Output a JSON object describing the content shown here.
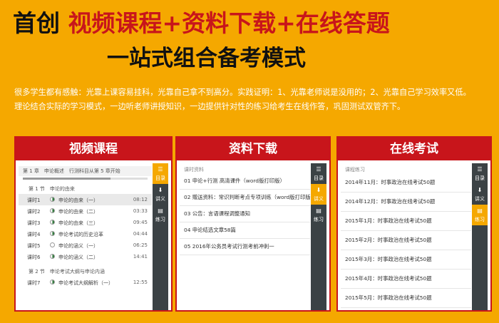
{
  "hero": {
    "part1": "首创 ",
    "part2": "视频课程+资料下载+在线答题",
    "line2": "一站式组合备考模式"
  },
  "intro": {
    "line1": "很多学生都有感触：光靠上课容易挂科，光靠自己拿不到高分。实践证明：1、光靠老师说是没用的；2、光靠自己学习效率又低。",
    "line2": "理论结合实际的学习模式，一边听老师讲授知识，一边提供针对性的练习给考生在线作答，巩固测试双管齐下。"
  },
  "sidebar": {
    "catalog": "目录",
    "handout": "讲义",
    "practice": "练习"
  },
  "video_card": {
    "title": "视频课程",
    "chapter": "第 1 章　申论概述　行测科目从第 5 章开始",
    "section1": "第 1 节　申论的由来",
    "lessons": [
      {
        "code": "课时1",
        "title": "申论的由来（一）",
        "time": "08:12",
        "active": true,
        "watched": true
      },
      {
        "code": "课时2",
        "title": "申论的由来（二）",
        "time": "03:33",
        "active": false,
        "watched": true
      },
      {
        "code": "课时3",
        "title": "申论的由来（三）",
        "time": "09:45",
        "active": false,
        "watched": true
      },
      {
        "code": "课时4",
        "title": "申论考试的历史沿革",
        "time": "04:44",
        "active": false,
        "watched": true
      },
      {
        "code": "课时5",
        "title": "申论的涵义（一）",
        "time": "06:25",
        "active": false,
        "watched": false
      },
      {
        "code": "课时6",
        "title": "申论的涵义（二）",
        "time": "14:41",
        "active": false,
        "watched": true
      }
    ],
    "section2": "第 2 节　申论考试大纲与申论内涵",
    "lesson7": {
      "code": "课时7",
      "title": "申论考试大纲解析（一）",
      "time": "12:55"
    }
  },
  "materials_card": {
    "title": "资料下载",
    "header": "课时资料",
    "items": [
      "01 申论+行测 高清课件（word版打印版）",
      "02 赠送资料：常识判断考点专项训练（word版打印版）",
      "03 公告：言语课程调整通知",
      "04 申论结选文章58篇",
      "05 2016年公务员考试行测考前冲刺一"
    ]
  },
  "exam_card": {
    "title": "在线考试",
    "header": "课程练习",
    "items": [
      "2014年11月：时事政治在线考试50题",
      "2014年12月：时事政治在线考试50题",
      "2015年1月：时事政治在线考试50题",
      "2015年2月：时事政治在线考试50题",
      "2015年3月：时事政治在线考试50题",
      "2015年4月：时事政治在线考试50题",
      "2015年5月：时事政治在线考试50题",
      "2014年6月：时事政治在线考试50题"
    ]
  },
  "colors": {
    "background": "#f5a800",
    "brand_red": "#c8151b",
    "sidebar": "#3b4245"
  }
}
